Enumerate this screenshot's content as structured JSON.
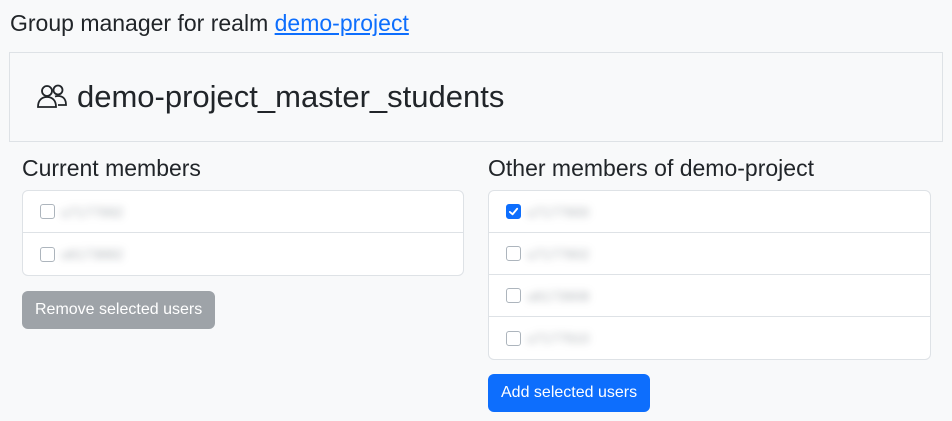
{
  "header": {
    "title_prefix": "Group manager for realm ",
    "realm_link": "demo-project"
  },
  "group": {
    "icon": "people-icon",
    "name": "demo-project_master_students"
  },
  "current_members": {
    "title": "Current members",
    "users": [
      {
        "name": "u7177992",
        "checked": false
      },
      {
        "name": "u6173882",
        "checked": false
      }
    ],
    "remove_button": "Remove selected users",
    "remove_button_disabled": true
  },
  "other_members": {
    "title": "Other members of demo-project",
    "users": [
      {
        "name": "u7177900",
        "checked": true
      },
      {
        "name": "u7177902",
        "checked": false
      },
      {
        "name": "u6173908",
        "checked": false
      },
      {
        "name": "u7177910",
        "checked": false
      }
    ],
    "add_button": "Add selected users"
  },
  "colors": {
    "primary": "#0d6efd",
    "disabled_button": "#9ea3a8",
    "background": "#f8f9fa",
    "border": "#dee2e6"
  }
}
